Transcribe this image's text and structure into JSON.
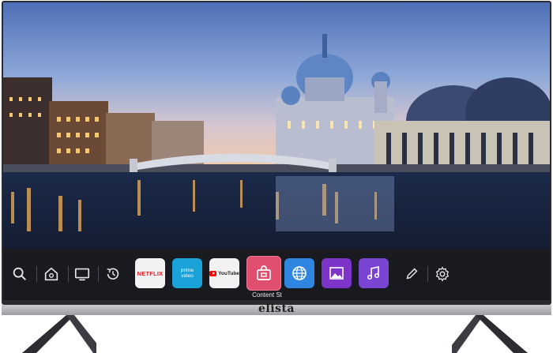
{
  "device": {
    "brand": "elista"
  },
  "launcher": {
    "apps": [
      {
        "name": "Netflix",
        "label": "NETFLIX",
        "color": "#f2f2f2"
      },
      {
        "name": "Prime Video",
        "label_line1": "prime",
        "label_line2": "video",
        "color": "#1aa3d8"
      },
      {
        "name": "YouTube",
        "label": "YouTube",
        "color": "#f2f2f2"
      },
      {
        "name": "Content Store",
        "color": "#e0506e"
      },
      {
        "name": "Web Browser",
        "color": "#2e86e0"
      },
      {
        "name": "Gallery",
        "color": "#7c34c9"
      },
      {
        "name": "Music",
        "color": "#7a45d3"
      }
    ],
    "focused_caption": "Content St"
  },
  "icons": [
    "search-icon",
    "home-icon",
    "tv-icon",
    "recent-history-icon",
    "edit-icon",
    "settings-icon"
  ]
}
